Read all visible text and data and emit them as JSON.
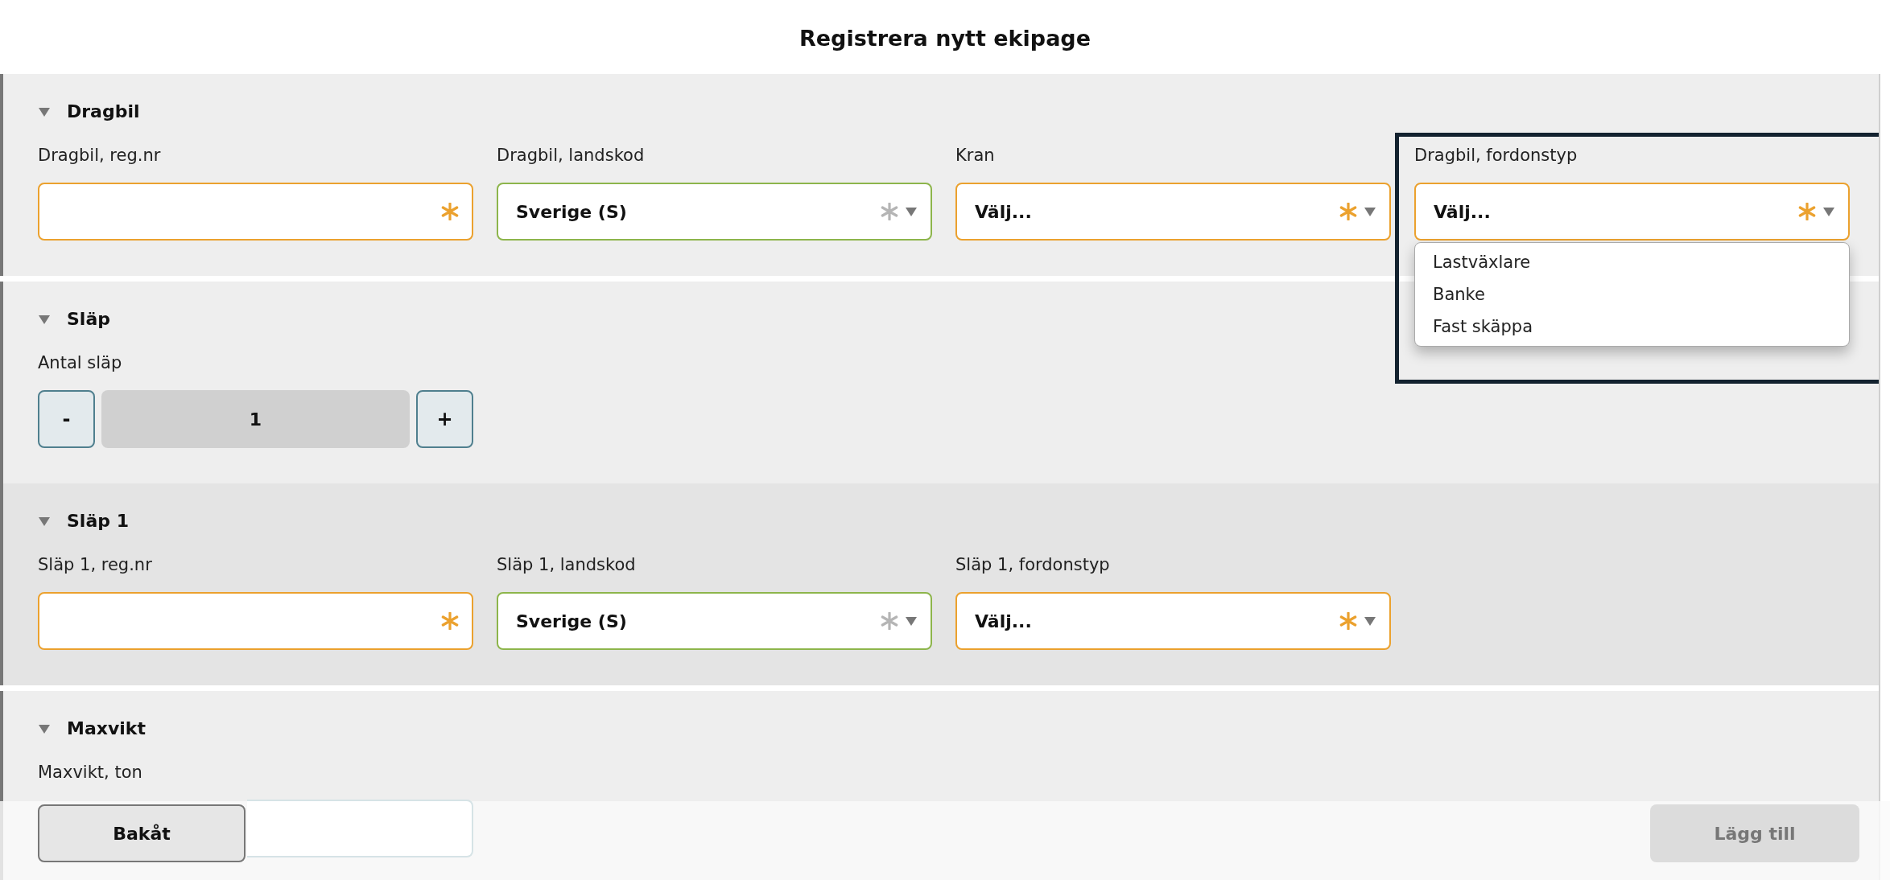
{
  "title": "Registrera nytt ekipage",
  "sections": [
    {
      "title": "Dragbil",
      "expanded": true,
      "hovered": false,
      "fields": [
        {
          "kind": "text",
          "label": "Dragbil, reg.nr",
          "valid": false
        },
        {
          "kind": "select",
          "label": "Dragbil, landskod",
          "value": "Sverige (S)",
          "valid": true
        },
        {
          "kind": "select",
          "label": "Kran",
          "value": "Välj...",
          "valid": false
        },
        {
          "kind": "select",
          "label": "Dragbil, fordonstyp",
          "value": "Välj...",
          "valid": false,
          "highlighted": true,
          "open": true,
          "options": [
            "Lastväxlare",
            "Banke",
            "Fast skäppa"
          ]
        }
      ]
    },
    {
      "title": "Släp",
      "expanded": true,
      "hovered": false,
      "fields": [
        {
          "kind": "stepper",
          "label": "Antal släp",
          "value": "1",
          "minus": "-",
          "plus": "+"
        }
      ]
    },
    {
      "title": "Släp 1",
      "expanded": true,
      "hovered": true,
      "fields": [
        {
          "kind": "text",
          "label": "Släp 1, reg.nr",
          "valid": false
        },
        {
          "kind": "select",
          "label": "Släp 1, landskod",
          "value": "Sverige (S)",
          "valid": true
        },
        {
          "kind": "select",
          "label": "Släp 1, fordonstyp",
          "value": "Välj...",
          "valid": false
        }
      ]
    },
    {
      "title": "Maxvikt",
      "expanded": true,
      "hovered": false,
      "fields": [
        {
          "kind": "plain",
          "label": "Maxvikt, ton"
        }
      ]
    }
  ],
  "footer": {
    "buttons": [
      {
        "label": "Bakåt",
        "disabled": false
      },
      {
        "label": "Lägg till",
        "disabled": true
      }
    ]
  }
}
